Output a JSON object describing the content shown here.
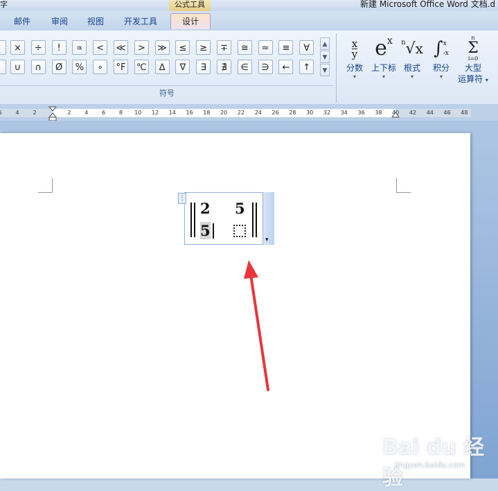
{
  "titlebar": {
    "left_fragment": "字",
    "context_tab": "公式工具",
    "document_title": "新建 Microsoft Office Word 文档.d"
  },
  "tabs": [
    {
      "label": "邮件"
    },
    {
      "label": "审阅"
    },
    {
      "label": "视图"
    },
    {
      "label": "开发工具"
    },
    {
      "label": "设计",
      "active": true
    }
  ],
  "symbols": {
    "row1": [
      "×",
      "÷",
      "!",
      "∝",
      "<",
      "≪",
      ">",
      "≫",
      "≤",
      "≥",
      "∓",
      "≅",
      "≈",
      "≡",
      "∀"
    ],
    "row2": [
      "∪",
      "∩",
      "Ø",
      "%",
      "∘",
      "°F",
      "℃",
      "∆",
      "∇",
      "∃",
      "∄",
      "∈",
      "∋",
      "←",
      "↑"
    ],
    "group_label": "符号",
    "scroll_up": "▲",
    "scroll_down": "▼",
    "scroll_more": "▼"
  },
  "structures": [
    {
      "name": "fraction",
      "icon_top": "x",
      "icon_bottom": "y",
      "label": "分数",
      "dropdown": "▾"
    },
    {
      "name": "script",
      "icon_base": "e",
      "icon_sup": "x",
      "label": "上下标",
      "dropdown": "▾"
    },
    {
      "name": "radical",
      "icon_index": "n",
      "icon_sign": "√",
      "icon_base": "x",
      "label": "根式",
      "dropdown": "▾"
    },
    {
      "name": "integral",
      "icon_sign": "∫",
      "icon_top": "x",
      "icon_bottom": "-x",
      "label": "积分",
      "dropdown": "▾"
    },
    {
      "name": "large-operator",
      "icon_top": "n",
      "icon_sign": "Σ",
      "icon_bottom": "i=0",
      "label_line1": "大型",
      "label_line2": "运算符",
      "dropdown": "▾"
    }
  ],
  "ruler": {
    "left_ticks": [
      "6",
      "4",
      "2"
    ],
    "right_ticks": [
      "2",
      "4",
      "6",
      "8",
      "10",
      "12",
      "14",
      "16",
      "18",
      "20",
      "22",
      "24",
      "26",
      "28",
      "30",
      "32",
      "34",
      "36",
      "38",
      "40",
      "42",
      "44",
      "46",
      "48"
    ]
  },
  "equation": {
    "top_left": "2",
    "top_right": "5",
    "bottom_left": "5",
    "handle": "⋮",
    "dropdown": "▾"
  },
  "watermark": {
    "brand": "Bai du 经验",
    "url": "jingyan.baidu.com"
  },
  "colors": {
    "arrow": "#e8353a",
    "ribbon_text": "#15428b",
    "active_tab": "#fbe5c9"
  }
}
